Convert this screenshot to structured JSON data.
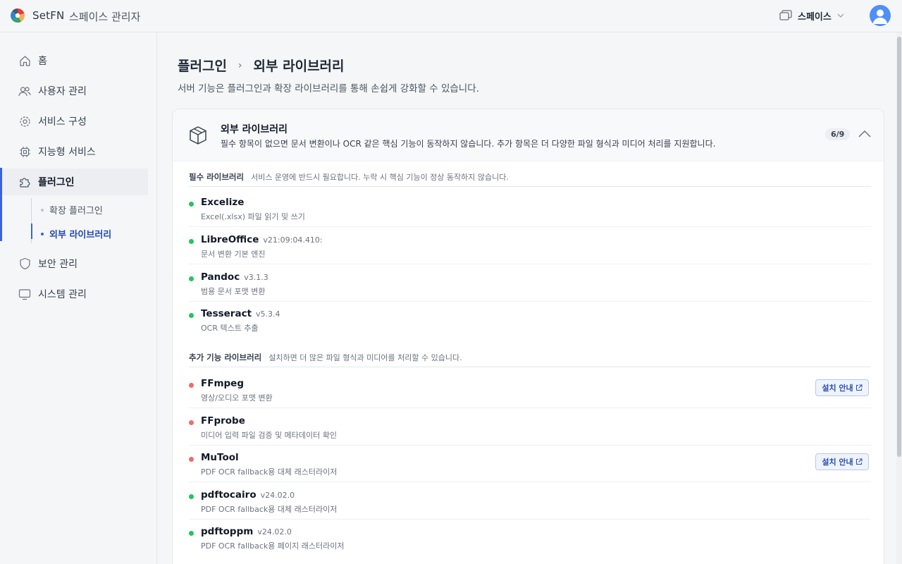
{
  "header": {
    "brand": "SetFN",
    "brand_sub": "스페이스 관리자",
    "space_label": "스페이스"
  },
  "sidebar": {
    "items": [
      {
        "label": "홈",
        "icon": "home-icon"
      },
      {
        "label": "사용자 관리",
        "icon": "users-icon"
      },
      {
        "label": "서비스 구성",
        "icon": "gear-icon"
      },
      {
        "label": "지능형 서비스",
        "icon": "chip-icon"
      },
      {
        "label": "플러그인",
        "icon": "puzzle-icon"
      },
      {
        "label": "보안 관리",
        "icon": "shield-icon"
      },
      {
        "label": "시스템 관리",
        "icon": "monitor-icon"
      }
    ],
    "sub_items": [
      {
        "label": "확장 플러그인"
      },
      {
        "label": "외부 라이브러리"
      }
    ],
    "active_item": "플러그인",
    "active_sub_item": "외부 라이브러리"
  },
  "main": {
    "breadcrumb": [
      "플러그인",
      "외부 라이브러리"
    ],
    "subtitle": "서버 기능은 플러그인과 확장 라이브러리를 통해 손쉽게 강화할 수 있습니다.",
    "card": {
      "title": "외부 라이브러리",
      "desc": "필수 항목이 없으면 문서 변환이나 OCR 같은 핵심 기능이 동작하지 않습니다. 추가 항목은 더 다양한 파일 형식과 미디어 처리를 지원합니다.",
      "count": "6/9",
      "required": {
        "title": "필수 라이브러리",
        "desc": "서비스 운영에 반드시 필요합니다. 누락 시 핵심 기능이 정상 동작하지 않습니다.",
        "libs": [
          {
            "name": "Excelize",
            "version": "",
            "desc": "Excel(.xlsx) 파일 읽기 및 쓰기",
            "status": "installed"
          },
          {
            "name": "LibreOffice",
            "version": "v21:09:04.410:",
            "desc": "문서 변환 기본 엔진",
            "status": "installed"
          },
          {
            "name": "Pandoc",
            "version": "v3.1.3",
            "desc": "범용 문서 포맷 변환",
            "status": "installed"
          },
          {
            "name": "Tesseract",
            "version": "v5.3.4",
            "desc": "OCR 텍스트 추출",
            "status": "installed"
          }
        ]
      },
      "optional": {
        "title": "추가 기능 라이브러리",
        "desc": "설치하면 더 많은 파일 형식과 미디어를 처리할 수 있습니다.",
        "libs": [
          {
            "name": "FFmpeg",
            "version": "",
            "desc": "영상/오디오 포맷 변환",
            "status": "missing",
            "action": "설치 안내"
          },
          {
            "name": "FFprobe",
            "version": "",
            "desc": "미디어 입력 파일 검증 및 메타데이터 확인",
            "status": "missing"
          },
          {
            "name": "MuTool",
            "version": "",
            "desc": "PDF OCR fallback용 대체 래스터라이저",
            "status": "missing",
            "action": "설치 안내"
          },
          {
            "name": "pdftocairo",
            "version": "v24.02.0",
            "desc": "PDF OCR fallback용 대체 래스터라이저",
            "status": "installed"
          },
          {
            "name": "pdftoppm",
            "version": "v24.02.0",
            "desc": "PDF OCR fallback용 페이지 래스터라이저",
            "status": "installed"
          }
        ]
      }
    }
  },
  "colors": {
    "accent": "#3b63d9",
    "ok": "#22c55e",
    "missing": "#ef6b6b"
  }
}
